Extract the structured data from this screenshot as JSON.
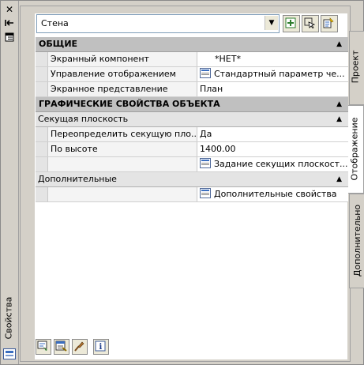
{
  "left_strip": {
    "close_symbol": "✕",
    "title": "Свойства"
  },
  "toolbar": {
    "object_type": "Стена"
  },
  "sections": {
    "general": {
      "title": "ОБЩИЕ",
      "rows": [
        {
          "name": "Экранный компонент",
          "value": "*НЕТ*"
        },
        {
          "name": "Управление отображением",
          "value": "Стандартный параметр че..."
        },
        {
          "name": "Экранное представление",
          "value": "План"
        }
      ]
    },
    "graphic": {
      "title": "ГРАФИЧЕСКИЕ СВОЙСТВА ОБЪЕКТА",
      "subsection": "Секущая плоскость",
      "rows": [
        {
          "name": "Переопределить секущую пло...",
          "value": "Да"
        },
        {
          "name": "По высоте",
          "value": "1400.00"
        },
        {
          "name": "",
          "value": "Задание секущих плоскост..."
        }
      ]
    },
    "additional": {
      "subsection": "Дополнительные",
      "rows": [
        {
          "name": "",
          "value": "Дополнительные свойства"
        }
      ]
    }
  },
  "tabs": [
    "Проект",
    "Отображение",
    "Дополнительно"
  ],
  "icons": {
    "close": "close-icon",
    "autohide": "autohide-icon",
    "menu": "menu-icon",
    "palette": "palette-icon"
  }
}
